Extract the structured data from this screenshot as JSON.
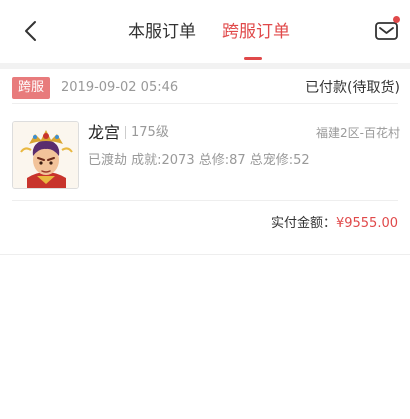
{
  "header": {
    "tabs": [
      {
        "label": "本服订单",
        "active": false
      },
      {
        "label": "跨服订单",
        "active": true
      }
    ],
    "accent_color": "#e0494a"
  },
  "order": {
    "badge": "跨服",
    "date": "2019-09-02 05:46",
    "status": "已付款(待取货)",
    "item": {
      "name": "龙宫",
      "level": "175级",
      "server": "福建2区-百花村",
      "stats": "已渡劫 成就:2073 总修:87 总宠修:52"
    },
    "pay_label": "实付金额：",
    "pay_value": "¥9555.00"
  }
}
